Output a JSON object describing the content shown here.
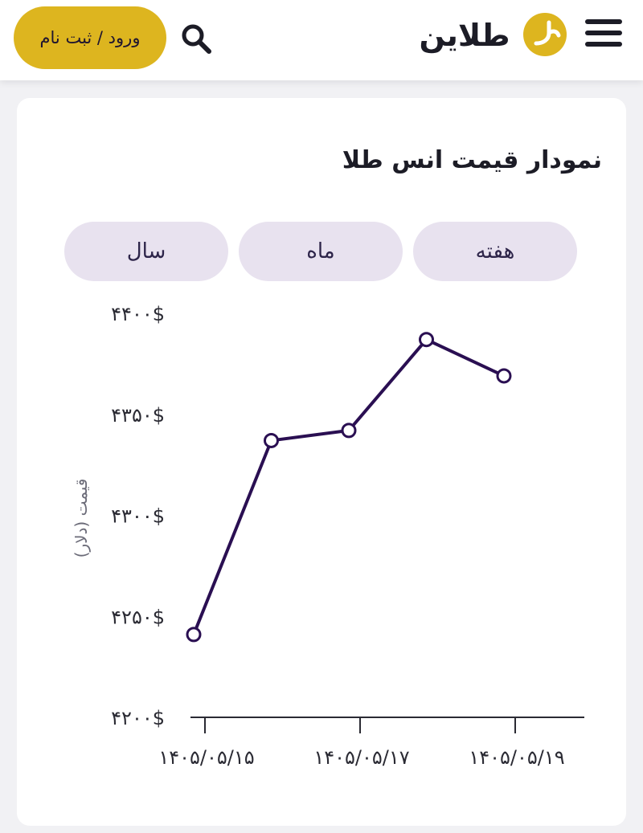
{
  "header": {
    "login_label": "ورود / ثبت نام",
    "logo_text": "طلاین",
    "icons": {
      "search": "search-icon",
      "menu": "hamburger-menu-icon",
      "logo": "logo-mark-icon"
    }
  },
  "card": {
    "title": "نمودار قیمت انس طلا",
    "tabs": [
      {
        "label": "سال"
      },
      {
        "label": "ماه"
      },
      {
        "label": "هفته"
      }
    ]
  },
  "colors": {
    "accent": "#ddb51f",
    "line": "#2a0f52",
    "tab_bg": "#e8e2ef"
  },
  "chart_data": {
    "type": "line",
    "ylabel": "قیمت (دلار)",
    "ylim": [
      4200,
      4400
    ],
    "y_ticks": [
      {
        "value": 4400,
        "label": "۴۴۰۰$"
      },
      {
        "value": 4350,
        "label": "۴۳۵۰$"
      },
      {
        "value": 4300,
        "label": "۴۳۰۰$"
      },
      {
        "value": 4250,
        "label": "۴۲۵۰$"
      },
      {
        "value": 4200,
        "label": "۴۲۰۰$"
      }
    ],
    "x_ticks": [
      "۱۴۰۵/۰۵/۱۵",
      "۱۴۰۵/۰۵/۱۷",
      "۱۴۰۵/۰۵/۱۹"
    ],
    "x_tick_indices": [
      0,
      2,
      4
    ],
    "series": [
      {
        "values": [
          4241,
          4337,
          4342,
          4387,
          4369
        ]
      }
    ],
    "grid": false
  }
}
